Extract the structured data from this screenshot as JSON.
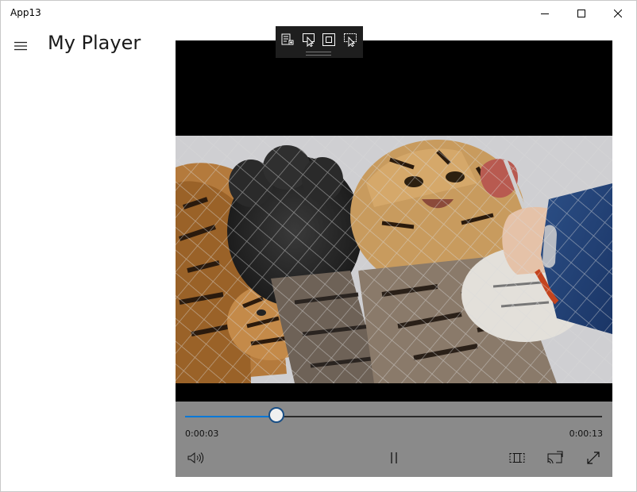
{
  "window": {
    "title": "App13"
  },
  "header": {
    "title": "My Player"
  },
  "debug_toolbar": {
    "items": [
      {
        "icon": "live-visual-tree-icon"
      },
      {
        "icon": "select-element-icon"
      },
      {
        "icon": "display-layout-adorners-icon"
      },
      {
        "icon": "track-focused-element-icon"
      }
    ]
  },
  "player": {
    "progress": 0.22,
    "elapsed": "0:00:03",
    "remaining": "0:00:13",
    "accent_color": "#0078d7",
    "controls": [
      {
        "icon": "volume-icon"
      },
      {
        "icon": "pause-icon"
      },
      {
        "icon": "zoom-icon"
      },
      {
        "icon": "cast-icon"
      },
      {
        "icon": "fullscreen-icon"
      }
    ]
  }
}
